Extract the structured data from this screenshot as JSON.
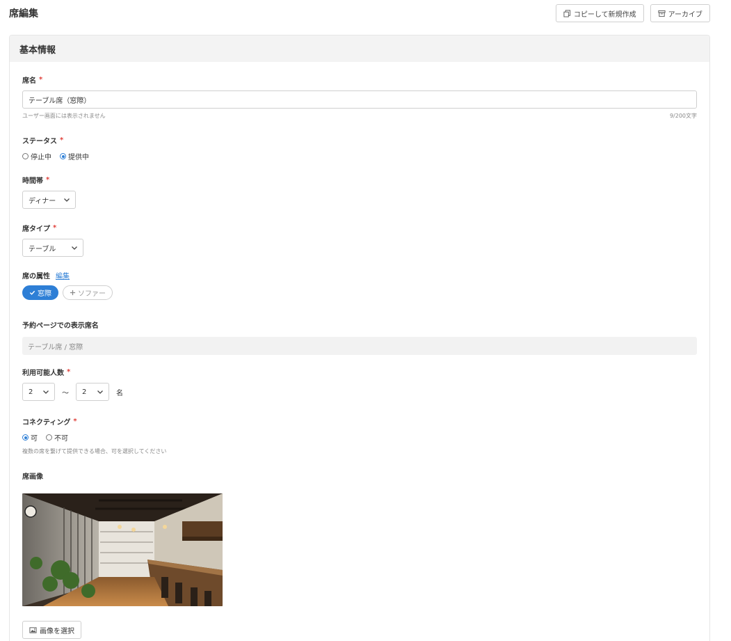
{
  "page": {
    "title": "席編集",
    "copy_button": "コピーして新規作成",
    "archive_button": "アーカイブ"
  },
  "section": {
    "title": "基本情報"
  },
  "seat_name": {
    "label": "席名",
    "required_mark": "*",
    "value": "テーブル席（窓際）",
    "hint": "ユーザー画面には表示されません",
    "counter": "9/200文字"
  },
  "status": {
    "label": "ステータス",
    "required_mark": "*",
    "options": [
      "停止中",
      "提供中"
    ],
    "selected": "提供中"
  },
  "time_slot": {
    "label": "時間帯",
    "required_mark": "*",
    "value": "ディナー"
  },
  "seat_type": {
    "label": "席タイプ",
    "required_mark": "*",
    "value": "テーブル"
  },
  "attributes": {
    "label": "席の属性",
    "edit_link": "編集",
    "chips": [
      {
        "label": "窓際",
        "active": true
      },
      {
        "label": "ソファー",
        "active": false
      }
    ]
  },
  "display_name": {
    "label": "予約ページでの表示席名",
    "value": "テーブル席 / 窓際"
  },
  "capacity": {
    "label": "利用可能人数",
    "required_mark": "*",
    "min": "2",
    "separator": "〜",
    "max": "2",
    "unit": "名"
  },
  "connecting": {
    "label": "コネクティング",
    "required_mark": "*",
    "options": [
      "可",
      "不可"
    ],
    "selected": "可",
    "hint": "複数の席を繋げて提供できる場合、可を選択してください"
  },
  "seat_image": {
    "label": "席画像",
    "select_button": "画像を選択"
  },
  "colors": {
    "accent": "#2e7fd6",
    "required": "#e0403a"
  }
}
